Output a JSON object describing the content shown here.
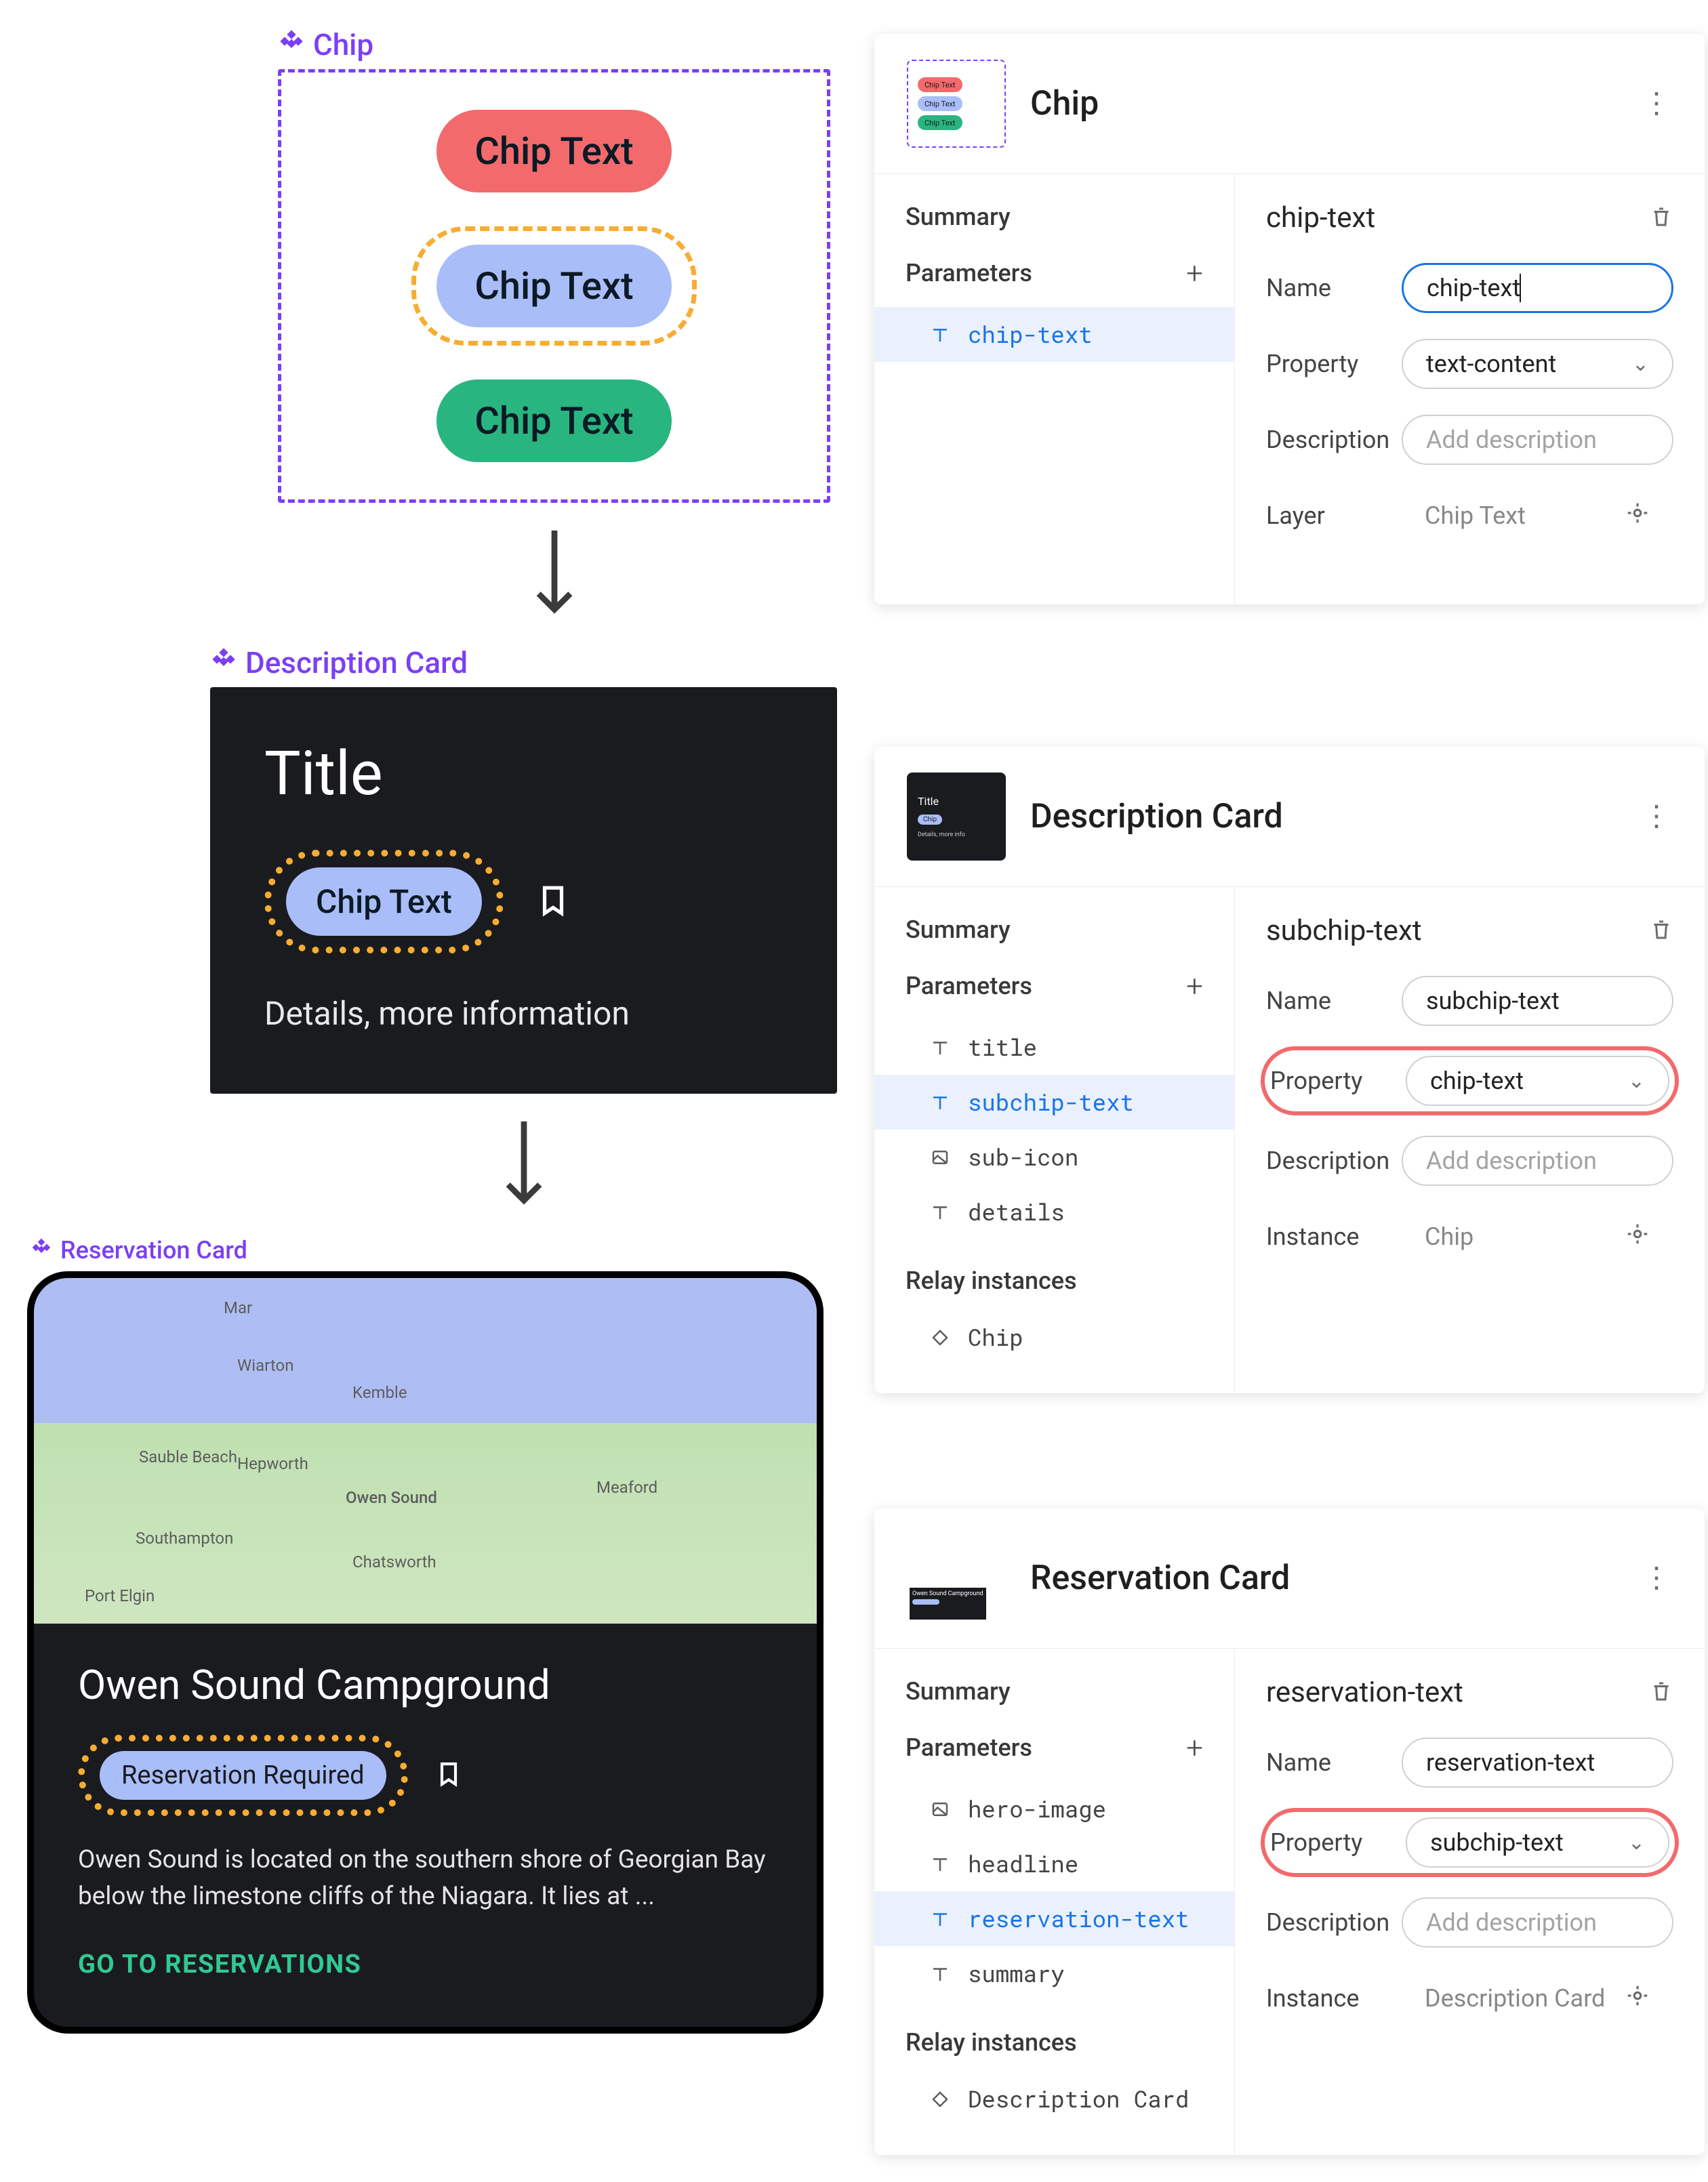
{
  "chip_section": {
    "label": "Chip",
    "chip1": "Chip Text",
    "chip2": "Chip Text",
    "chip3": "Chip Text"
  },
  "desc_section": {
    "label": "Description Card",
    "title": "Title",
    "chip": "Chip Text",
    "details": "Details, more information"
  },
  "res_section": {
    "label": "Reservation Card",
    "map_towns": [
      "Wiarton",
      "Kemble",
      "Sauble Beach",
      "Hepworth",
      "Owen Sound",
      "Meaford",
      "Southampton",
      "Chatsworth",
      "Port Elgin",
      "Mar"
    ],
    "headline": "Owen Sound Campground",
    "chip": "Reservation Required",
    "summary": "Owen Sound is located on the southern shore of Georgian Bay below the limestone cliffs of the Niagara. It lies at ...",
    "cta": "GO TO RESERVATIONS"
  },
  "panel_chip": {
    "title": "Chip",
    "summary_label": "Summary",
    "parameters_label": "Parameters",
    "params": [
      {
        "name": "chip-text",
        "icon": "text"
      }
    ],
    "detail": {
      "title": "chip-text",
      "name_label": "Name",
      "name_value": "chip-text",
      "property_label": "Property",
      "property_value": "text-content",
      "description_label": "Description",
      "description_placeholder": "Add description",
      "layer_label": "Layer",
      "layer_value": "Chip Text"
    }
  },
  "panel_desc": {
    "title": "Description Card",
    "summary_label": "Summary",
    "parameters_label": "Parameters",
    "params": [
      {
        "name": "title",
        "icon": "text"
      },
      {
        "name": "subchip-text",
        "icon": "text",
        "active": true
      },
      {
        "name": "sub-icon",
        "icon": "image"
      },
      {
        "name": "details",
        "icon": "text"
      }
    ],
    "relay_label": "Relay instances",
    "relay_items": [
      {
        "name": "Chip",
        "icon": "diamond"
      }
    ],
    "detail": {
      "title": "subchip-text",
      "name_label": "Name",
      "name_value": "subchip-text",
      "property_label": "Property",
      "property_value": "chip-text",
      "description_label": "Description",
      "description_placeholder": "Add description",
      "instance_label": "Instance",
      "instance_value": "Chip"
    }
  },
  "panel_res": {
    "title": "Reservation Card",
    "summary_label": "Summary",
    "parameters_label": "Parameters",
    "params": [
      {
        "name": "hero-image",
        "icon": "image"
      },
      {
        "name": "headline",
        "icon": "text"
      },
      {
        "name": "reservation-text",
        "icon": "text",
        "active": true
      },
      {
        "name": "summary",
        "icon": "text"
      }
    ],
    "relay_label": "Relay instances",
    "relay_items": [
      {
        "name": "Description Card",
        "icon": "diamond"
      }
    ],
    "detail": {
      "title": "reservation-text",
      "name_label": "Name",
      "name_value": "reservation-text",
      "property_label": "Property",
      "property_value": "subchip-text",
      "description_label": "Description",
      "description_placeholder": "Add description",
      "instance_label": "Instance",
      "instance_value": "Description Card"
    }
  }
}
